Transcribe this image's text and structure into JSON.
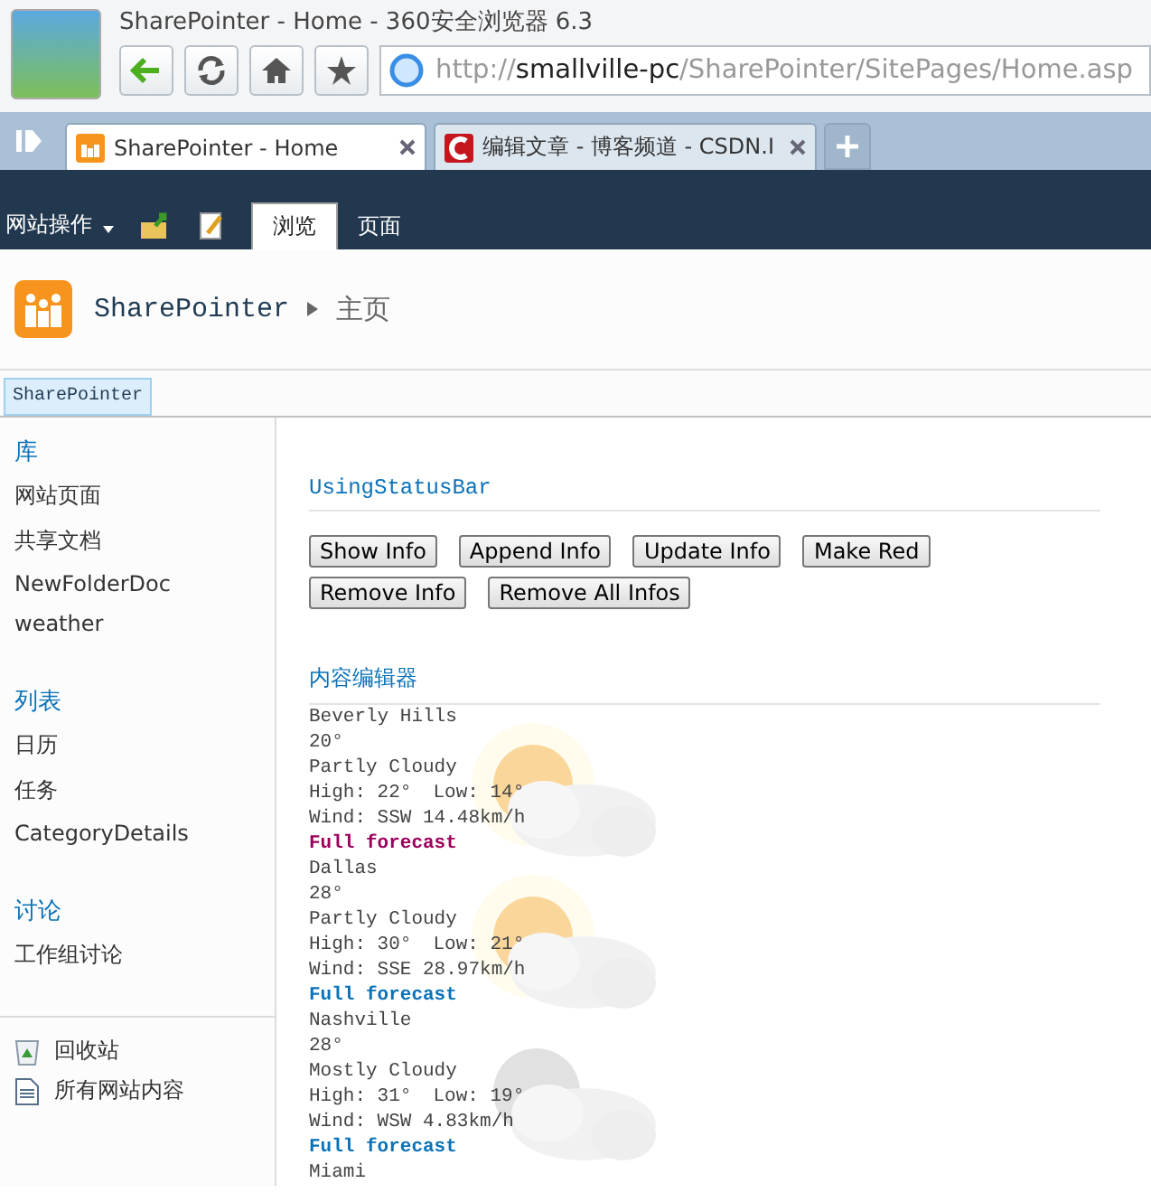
{
  "window": {
    "title": "SharePointer - Home - 360安全浏览器 6.3"
  },
  "address_bar": {
    "scheme": "http://",
    "host": "smallville-pc",
    "path": "/SharePointer/SitePages/Home.asp"
  },
  "browser_tabs": [
    {
      "label": "SharePointer - Home",
      "selected": true,
      "kind": "sharepoint"
    },
    {
      "label": "编辑文章 - 博客频道 - CSDN.I",
      "selected": false,
      "kind": "csdn"
    }
  ],
  "ribbon": {
    "site_actions": "网站操作",
    "tabs": [
      {
        "label": "浏览",
        "selected": true
      },
      {
        "label": "页面",
        "selected": false
      }
    ]
  },
  "site_title": {
    "site": "SharePointer",
    "page": "主页"
  },
  "top_nav": [
    {
      "label": "SharePointer",
      "selected": true
    }
  ],
  "sidebar": {
    "sections": [
      {
        "heading": "库",
        "items": [
          "网站页面",
          "共享文档",
          "NewFolderDoc",
          "weather"
        ]
      },
      {
        "heading": "列表",
        "items": [
          "日历",
          "任务",
          "CategoryDetails"
        ]
      },
      {
        "heading": "讨论",
        "items": [
          "工作组讨论"
        ]
      }
    ],
    "footer_links": [
      {
        "label": "回收站",
        "kind": "recycle"
      },
      {
        "label": "所有网站内容",
        "kind": "content"
      }
    ]
  },
  "status_part": {
    "title": "UsingStatusBar",
    "buttons": [
      "Show Info",
      "Append Info",
      "Update Info",
      "Make Red",
      "Remove Info",
      "Remove All Infos"
    ]
  },
  "content_editor": {
    "title": "内容编辑器",
    "cities": [
      {
        "city": "Beverly Hills",
        "temp": "20°",
        "condition": "Partly Cloudy",
        "high": "High: 22°",
        "low": "Low: 14°",
        "wind": "Wind: SSW 14.48km/h",
        "link": "Full forecast",
        "visited": true,
        "kind": "partly"
      },
      {
        "city": "Dallas",
        "temp": "28°",
        "condition": "Partly Cloudy",
        "high": "High: 30°",
        "low": "Low: 21°",
        "wind": "Wind: SSE 28.97km/h",
        "link": "Full forecast",
        "visited": false,
        "kind": "partly"
      },
      {
        "city": "Nashville",
        "temp": "28°",
        "condition": "Mostly Cloudy",
        "high": "High: 31°",
        "low": "Low: 19°",
        "wind": "Wind: WSW 4.83km/h",
        "link": "Full forecast",
        "visited": false,
        "kind": "mostly"
      }
    ],
    "cut_off_city": "Miami"
  }
}
